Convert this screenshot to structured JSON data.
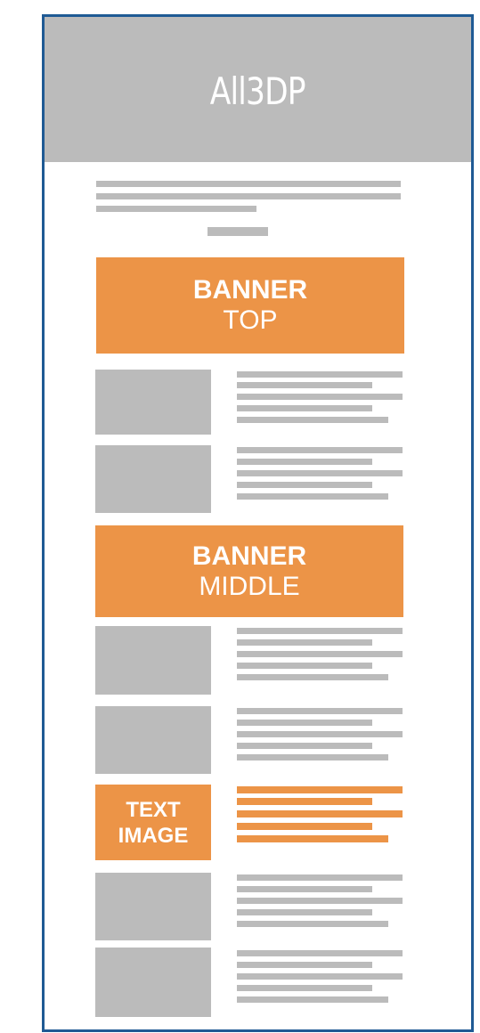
{
  "header": {
    "logo": "All3DP"
  },
  "banners": {
    "top": {
      "line1": "BANNER",
      "line2": "TOP"
    },
    "middle": {
      "line1": "BANNER",
      "line2": "MIDDLE"
    }
  },
  "text_image": {
    "line1": "TEXT",
    "line2": "IMAGE"
  },
  "colors": {
    "frame": "#1f5a94",
    "placeholder": "#bbbbbb",
    "accent": "#ec9447",
    "text": "#ffffff"
  }
}
